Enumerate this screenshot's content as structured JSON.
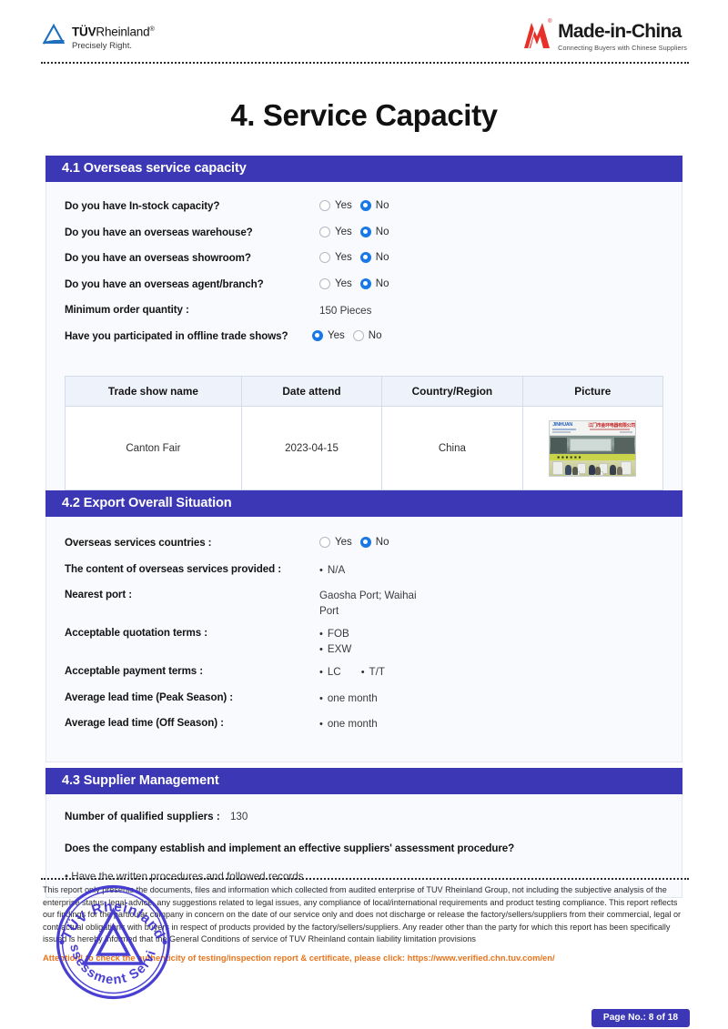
{
  "header": {
    "tuv_logo": {
      "name_bold": "TÜV",
      "name_rest": "Rheinland",
      "registered_mark": "®",
      "tagline": "Precisely Right."
    },
    "mic_logo": {
      "name": "Made-in-China",
      "tagline": "Connecting Buyers with Chinese Suppliers",
      "registered_mark": "®",
      "brand_color": "#e8302a"
    }
  },
  "document": {
    "title": "4. Service Capacity",
    "accent_color": "#3b37b5",
    "panel_bg": "#f8fafd",
    "radio_color": "#1878e6"
  },
  "section_41": {
    "heading": "4.1 Overseas service capacity",
    "questions": [
      {
        "label": "Do you have In-stock capacity?",
        "yes_label": "Yes",
        "no_label": "No",
        "selected": "No"
      },
      {
        "label": "Do you have an overseas warehouse?",
        "yes_label": "Yes",
        "no_label": "No",
        "selected": "No"
      },
      {
        "label": "Do you have an overseas showroom?",
        "yes_label": "Yes",
        "no_label": "No",
        "selected": "No"
      },
      {
        "label": "Do you have an overseas agent/branch?",
        "yes_label": "Yes",
        "no_label": "No",
        "selected": "No"
      }
    ],
    "moq": {
      "label": "Minimum order quantity :",
      "value": "150 Pieces"
    },
    "trade_show_question": {
      "label": "Have you participated in offline trade shows?",
      "yes_label": "Yes",
      "no_label": "No",
      "selected": "Yes"
    },
    "trade_show_table": {
      "columns": [
        "Trade show name",
        "Date attend",
        "Country/Region",
        "Picture"
      ],
      "rows": [
        {
          "name": "Canton Fair",
          "date": "2023-04-15",
          "country": "China",
          "picture_alt": "trade-show-booth-photo",
          "picture_banner_brand": "JINHUAN",
          "picture_banner_cn": "江门市金环电器有限公司"
        }
      ]
    }
  },
  "section_42": {
    "heading": "4.2 Export Overall Situation",
    "overseas_countries": {
      "label": "Overseas services countries :",
      "yes_label": "Yes",
      "no_label": "No",
      "selected": "No"
    },
    "overseas_content": {
      "label": "The content of overseas services provided :",
      "values": [
        "N/A"
      ]
    },
    "nearest_port": {
      "label": "Nearest port :",
      "value_line1": "Gaosha Port; Waihai",
      "value_line2": "Port"
    },
    "quotation_terms": {
      "label": "Acceptable quotation terms :",
      "values": [
        "FOB",
        "EXW"
      ]
    },
    "payment_terms": {
      "label": "Acceptable payment terms :",
      "values": [
        "LC",
        "T/T"
      ]
    },
    "lead_time_peak": {
      "label": "Average lead time (Peak Season) :",
      "values": [
        "one month"
      ]
    },
    "lead_time_off": {
      "label": "Average lead time (Off Season) :",
      "values": [
        "one month"
      ]
    }
  },
  "section_43": {
    "heading": "4.3 Supplier Management",
    "qualified_suppliers": {
      "label": "Number of qualified suppliers :",
      "value": "130"
    },
    "assessment_question": "Does the company establish and implement an effective suppliers' assessment procedure?",
    "assessment_answer": "Have the written procedures and followed records"
  },
  "footer": {
    "disclaimer": "This report only presents the documents, files and information which collected from audited enterprise of TUV Rheinland Group, not including the subjective analysis of the enterprise status, legal advice, any suggestions related to legal issues, any compliance of local/international requirements and product testing compliance. This report reflects our findings for the particular company in concern on the date of our service only and does not discharge or release the factory/sellers/suppliers from their commercial, legal or contractual obligations with buyers in respect of products provided by the factory/sellers/suppliers. Any reader other than the party for which this report has been specifically issued is hereby informed that the General Conditions of service of TUV Rheinland contain liability limitation provisions",
    "attention": "Attention! to check the authenticity of testing/inspection report & certificate, please click:  https://www.verified.chn.tuv.com/en/",
    "attention_color": "#e8741c",
    "page_label": "Page No.: 8 of 18",
    "stamp": {
      "top_text": "TÜV Rheinland",
      "bottom_text": "Assessment Service",
      "color": "#3a2fd0"
    }
  }
}
